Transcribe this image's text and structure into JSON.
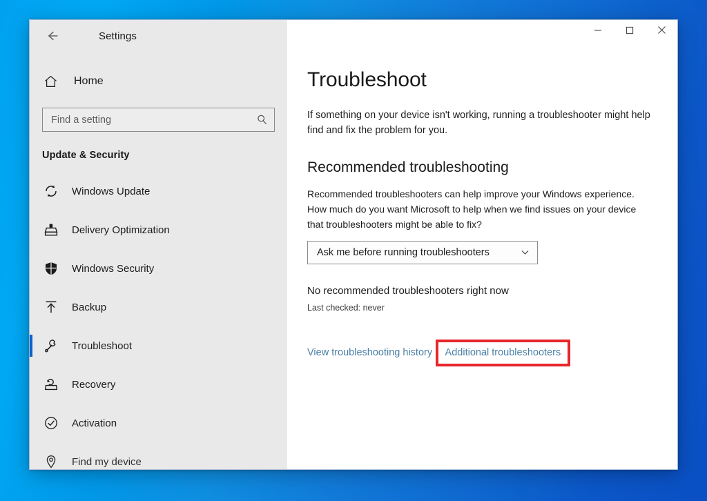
{
  "window": {
    "app_title": "Settings",
    "back_icon": "back-arrow-icon",
    "controls": {
      "minimize_label": "–",
      "maximize_label": "☐",
      "close_label": "✕"
    }
  },
  "sidebar": {
    "home": {
      "label": "Home",
      "icon": "home-icon"
    },
    "search": {
      "placeholder": "Find a setting",
      "value": "",
      "icon": "search-icon"
    },
    "section_title": "Update & Security",
    "items": [
      {
        "label": "Windows Update",
        "icon": "sync-refresh-icon",
        "selected": false
      },
      {
        "label": "Delivery Optimization",
        "icon": "delivery-box-icon",
        "selected": false
      },
      {
        "label": "Windows Security",
        "icon": "shield-icon",
        "selected": false
      },
      {
        "label": "Backup",
        "icon": "upload-arrow-icon",
        "selected": false
      },
      {
        "label": "Troubleshoot",
        "icon": "wrench-icon",
        "selected": true
      },
      {
        "label": "Recovery",
        "icon": "recovery-icon",
        "selected": false
      },
      {
        "label": "Activation",
        "icon": "check-circle-icon",
        "selected": false
      },
      {
        "label": "Find my device",
        "icon": "location-pin-icon",
        "selected": false
      }
    ]
  },
  "main": {
    "page_title": "Troubleshoot",
    "intro": "If something on your device isn't working, running a troubleshooter might help find and fix the problem for you.",
    "section": {
      "heading": "Recommended troubleshooting",
      "body": "Recommended troubleshooters can help improve your Windows experience. How much do you want Microsoft to help when we find issues on your device that troubleshooters might be able to fix?",
      "dropdown": {
        "selected": "Ask me before running troubleshooters",
        "chevron_icon": "chevron-down-icon"
      },
      "status_main": "No recommended troubleshooters right now",
      "status_sub": "Last checked: never"
    },
    "links": {
      "history": "View troubleshooting history",
      "additional": "Additional troubleshooters"
    }
  },
  "colors": {
    "accent": "#0a64c8",
    "link": "#4a7fa5",
    "highlight": "#e8262b",
    "sidebar_bg": "#e9e9e9",
    "content_bg": "#ffffff"
  }
}
